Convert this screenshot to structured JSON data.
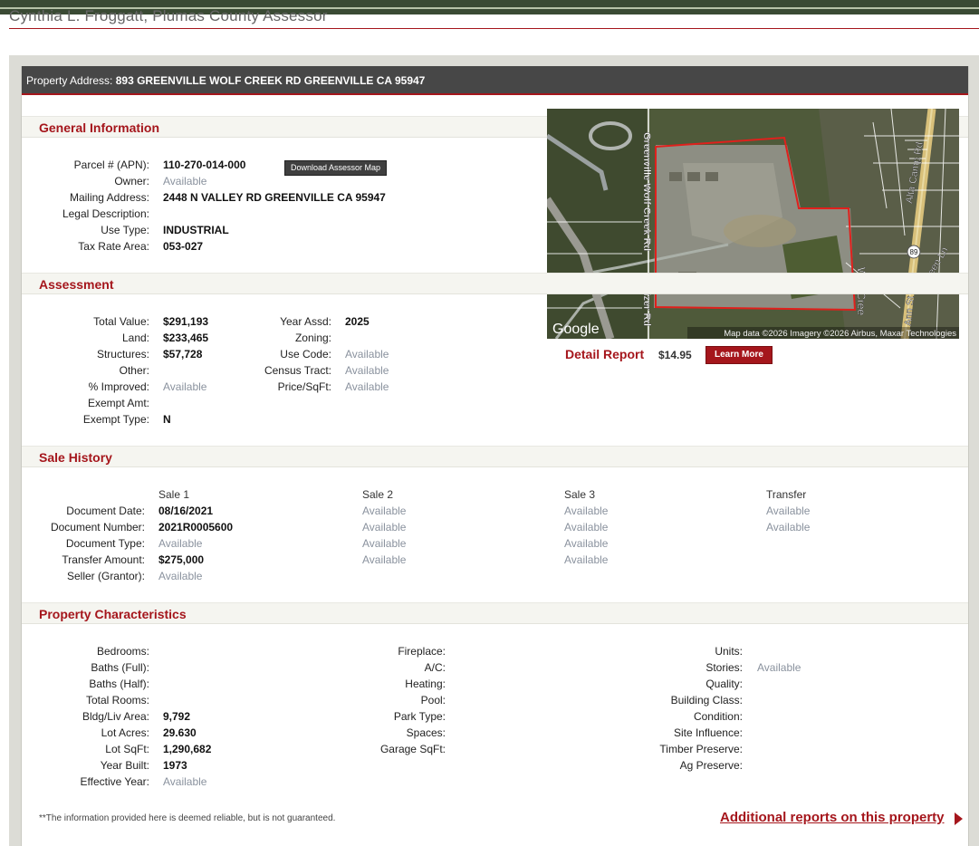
{
  "site": {
    "title": "Cynthia L. Froggatt, Plumas County Assessor"
  },
  "address_bar": {
    "label": "Property Address:",
    "value": "893 GREENVILLE WOLF CREEK RD GREENVILLE CA 95947"
  },
  "general": {
    "heading": "General Information",
    "download_button": "Download Assessor Map",
    "labels": {
      "apn": "Parcel # (APN):",
      "owner": "Owner:",
      "mailing": "Mailing Address:",
      "legal": "Legal Description:",
      "use_type": "Use Type:",
      "tax_rate": "Tax Rate Area:"
    },
    "values": {
      "apn": "110-270-014-000",
      "owner": "Available",
      "mailing": "2448 N VALLEY RD GREENVILLE CA 95947",
      "legal": "",
      "use_type": "INDUSTRIAL",
      "tax_rate": "053-027"
    }
  },
  "assessment": {
    "heading": "Assessment",
    "labels": {
      "total": "Total Value:",
      "land": "Land:",
      "structures": "Structures:",
      "other": "Other:",
      "improved": "% Improved:",
      "exempt_amt": "Exempt Amt:",
      "exempt_type": "Exempt Type:",
      "year_assd": "Year Assd:",
      "zoning": "Zoning:",
      "use_code": "Use Code:",
      "census": "Census Tract:",
      "price_sqft": "Price/SqFt:"
    },
    "values": {
      "total": "$291,193",
      "land": "$233,465",
      "structures": "$57,728",
      "other": "",
      "improved": "Available",
      "exempt_amt": "",
      "exempt_type": "N",
      "year_assd": "2025",
      "zoning": "",
      "use_code": "Available",
      "census": "Available",
      "price_sqft": "Available"
    }
  },
  "map": {
    "road_labels": [
      "Greenville Wolf Creek Rd",
      "Seizer Rd",
      "Wolf Cree",
      "Alta Camp Rd",
      "Green Ln",
      "Ann St"
    ],
    "shield": "89",
    "logo": "Google",
    "attribution": "Map data ©2026 Imagery ©2026 Airbus, Maxar Technologies",
    "colors": {
      "parcel_outline": "#e0201c",
      "imagery": "#4d5538"
    }
  },
  "detail_report": {
    "title": "Detail Report",
    "price": "$14.95",
    "button": "Learn More"
  },
  "sale_history": {
    "heading": "Sale History",
    "columns": [
      "Sale 1",
      "Sale 2",
      "Sale 3",
      "Transfer"
    ],
    "row_labels": {
      "doc_date": "Document Date:",
      "doc_number": "Document Number:",
      "doc_type": "Document Type:",
      "transfer_amount": "Transfer Amount:",
      "seller": "Seller (Grantor):"
    },
    "sale1": {
      "doc_date": "08/16/2021",
      "doc_number": "2021R0005600",
      "doc_type": "Available",
      "transfer_amount": "$275,000",
      "seller": "Available"
    },
    "sale2": {
      "doc_date": "Available",
      "doc_number": "Available",
      "doc_type": "Available",
      "transfer_amount": "Available"
    },
    "sale3": {
      "doc_date": "Available",
      "doc_number": "Available",
      "doc_type": "Available",
      "transfer_amount": "Available"
    },
    "transfer": {
      "doc_date": "Available",
      "doc_number": "Available"
    }
  },
  "characteristics": {
    "heading": "Property Characteristics",
    "labels": {
      "bedrooms": "Bedrooms:",
      "baths_full": "Baths (Full):",
      "baths_half": "Baths (Half):",
      "total_rooms": "Total Rooms:",
      "bldg_area": "Bldg/Liv Area:",
      "lot_acres": "Lot Acres:",
      "lot_sqft": "Lot SqFt:",
      "year_built": "Year Built:",
      "effective_year": "Effective Year:",
      "fireplace": "Fireplace:",
      "ac": "A/C:",
      "heating": "Heating:",
      "pool": "Pool:",
      "park_type": "Park Type:",
      "spaces": "Spaces:",
      "garage_sqft": "Garage SqFt:",
      "units": "Units:",
      "stories": "Stories:",
      "quality": "Quality:",
      "building_class": "Building Class:",
      "condition": "Condition:",
      "site_influence": "Site Influence:",
      "timber_preserve": "Timber Preserve:",
      "ag_preserve": "Ag Preserve:"
    },
    "values": {
      "bldg_area": "9,792",
      "lot_acres": "29.630",
      "lot_sqft": "1,290,682",
      "year_built": "1973",
      "effective_year": "Available",
      "stories": "Available"
    }
  },
  "footer": {
    "disclaimer": "**The information provided here is deemed reliable, but is not guaranteed.",
    "additional_reports": "Additional reports on this property"
  }
}
